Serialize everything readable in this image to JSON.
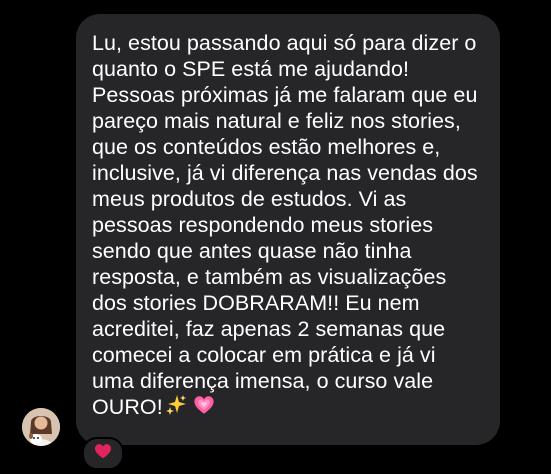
{
  "conversation": {
    "message": {
      "lines": [
        "Lu, estou passando aqui só para dizer o",
        "quanto o SPE está me ajudando!",
        "Pessoas próximas já me falaram que eu",
        "pareço mais natural e feliz nos stories,",
        "que os conteúdos estão melhores e,",
        "inclusive, já vi diferença nas vendas dos",
        "meus produtos de estudos. Vi as",
        "pessoas respondendo meus stories",
        "sendo que antes quase não tinha",
        "resposta, e também as visualizações",
        "dos stories DOBRARAM!! Eu nem",
        "acreditei, faz apenas 2 semanas que",
        "comecei a colocar em prática e já vi",
        "uma diferença imensa, o curso vale",
        "OURO!"
      ],
      "trailing_icons": [
        "sparkles-icon",
        "growing-heart-icon"
      ]
    },
    "reaction": {
      "icon": "red-heart-icon"
    },
    "sender": {
      "avatar_icon": "avatar"
    }
  },
  "colors": {
    "background": "#000000",
    "bubble": "#262628",
    "text": "#ffffff",
    "reaction_heart": "#e0245e",
    "pink_heart": "#ff5fa2",
    "sparkle": "#ffcc33"
  }
}
